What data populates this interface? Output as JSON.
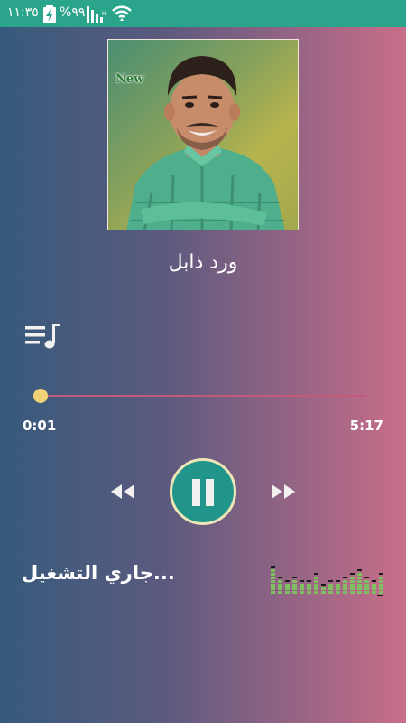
{
  "status_bar": {
    "time": "١١:٣٥",
    "battery": "%٩٩",
    "bg_color": "#2aa58b"
  },
  "album": {
    "badge": "New"
  },
  "song": {
    "title": "ورد ذابل"
  },
  "player": {
    "current_time": "0:01",
    "total_time": "5:17",
    "progress": 0.003,
    "state": "playing"
  },
  "now_playing": {
    "label": "جاري التشغيل..."
  },
  "icons": {
    "playlist": "playlist-music-icon",
    "rewind": "rewind-icon",
    "pause": "pause-icon",
    "forward": "fast-forward-icon",
    "equalizer": "equalizer-icon",
    "battery": "battery-charging-icon",
    "signal": "signal-icon",
    "wifi": "wifi-icon"
  },
  "colors": {
    "accent": "#21958a",
    "seek_thumb": "#f1d177",
    "seek_track": "#c25a7a"
  }
}
